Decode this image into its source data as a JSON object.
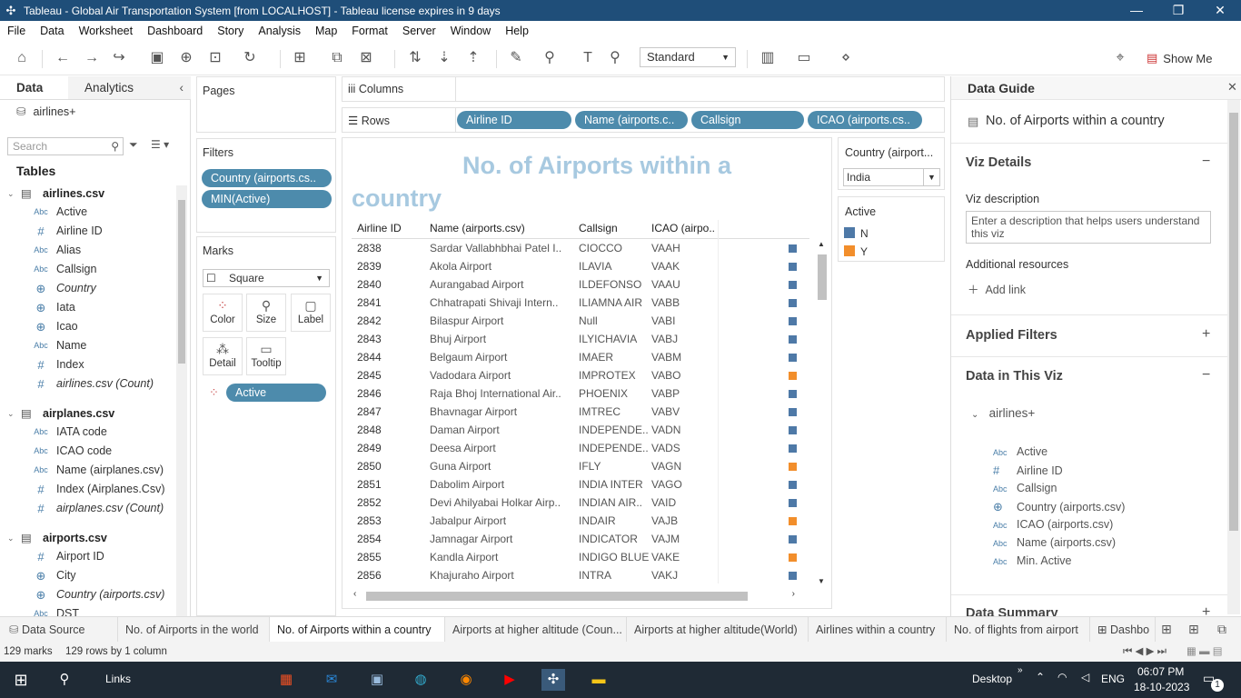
{
  "window": {
    "title": "Tableau - Global Air Transportation System [from LOCALHOST] - Tableau license expires in 9 days"
  },
  "menu": [
    "File",
    "Data",
    "Worksheet",
    "Dashboard",
    "Story",
    "Analysis",
    "Map",
    "Format",
    "Server",
    "Window",
    "Help"
  ],
  "toolbar": {
    "fit_mode": "Standard",
    "show_me": "Show Me"
  },
  "left_panel": {
    "tab_data": "Data",
    "tab_analytics": "Analytics",
    "data_source": "airlines+",
    "search_placeholder": "Search",
    "tables_heading": "Tables",
    "tables": [
      {
        "name": "airlines.csv",
        "fields": [
          {
            "type": "Abc",
            "name": "Active"
          },
          {
            "type": "#",
            "name": "Airline ID"
          },
          {
            "type": "Abc",
            "name": "Alias"
          },
          {
            "type": "Abc",
            "name": "Callsign"
          },
          {
            "type": "globe",
            "name": "Country"
          },
          {
            "type": "globe",
            "name": "Iata"
          },
          {
            "type": "globe",
            "name": "Icao"
          },
          {
            "type": "Abc",
            "name": "Name"
          },
          {
            "type": "#",
            "name": "Index"
          },
          {
            "type": "#",
            "name": "airlines.csv (Count)"
          }
        ]
      },
      {
        "name": "airplanes.csv",
        "fields": [
          {
            "type": "Abc",
            "name": "IATA code"
          },
          {
            "type": "Abc",
            "name": "ICAO code"
          },
          {
            "type": "Abc",
            "name": "Name (airplanes.csv)"
          },
          {
            "type": "#",
            "name": "Index (Airplanes.Csv)"
          },
          {
            "type": "#",
            "name": "airplanes.csv (Count)"
          }
        ]
      },
      {
        "name": "airports.csv",
        "fields": [
          {
            "type": "#",
            "name": "Airport ID"
          },
          {
            "type": "globe",
            "name": "City"
          },
          {
            "type": "globe",
            "name": "Country (airports.csv)"
          },
          {
            "type": "Abc",
            "name": "DST"
          }
        ]
      }
    ]
  },
  "pages": {
    "title": "Pages"
  },
  "filters": {
    "title": "Filters",
    "items": [
      "Country (airports.cs..",
      "MIN(Active)"
    ]
  },
  "marks": {
    "title": "Marks",
    "type": "Square",
    "buttons": [
      "Color",
      "Size",
      "Label",
      "Detail",
      "Tooltip"
    ],
    "color_pill": "Active"
  },
  "shelves": {
    "columns_label": "Columns",
    "rows_label": "Rows",
    "rows_pills": [
      "Airline ID",
      "Name (airports.c..",
      "Callsign",
      "ICAO (airports.cs.."
    ]
  },
  "viz": {
    "title_line1": "No. of Airports within a",
    "title_line2": "country",
    "headers": [
      "Airline ID",
      "Name (airports.csv)",
      "Callsign",
      "ICAO (airpo.."
    ],
    "rows": [
      {
        "id": "2838",
        "name": "Sardar Vallabhbhai Patel I..",
        "callsign": "CIOCCO",
        "icao": "VAAH",
        "active": "N"
      },
      {
        "id": "2839",
        "name": "Akola Airport",
        "callsign": "ILAVIA",
        "icao": "VAAK",
        "active": "N"
      },
      {
        "id": "2840",
        "name": "Aurangabad Airport",
        "callsign": "ILDEFONSO",
        "icao": "VAAU",
        "active": "N"
      },
      {
        "id": "2841",
        "name": "Chhatrapati Shivaji Intern..",
        "callsign": "ILIAMNA AIR",
        "icao": "VABB",
        "active": "N"
      },
      {
        "id": "2842",
        "name": "Bilaspur Airport",
        "callsign": "Null",
        "icao": "VABI",
        "active": "N"
      },
      {
        "id": "2843",
        "name": "Bhuj Airport",
        "callsign": "ILYICHAVIA",
        "icao": "VABJ",
        "active": "N"
      },
      {
        "id": "2844",
        "name": "Belgaum Airport",
        "callsign": "IMAER",
        "icao": "VABM",
        "active": "N"
      },
      {
        "id": "2845",
        "name": "Vadodara Airport",
        "callsign": "IMPROTEX",
        "icao": "VABO",
        "active": "Y"
      },
      {
        "id": "2846",
        "name": "Raja Bhoj International Air..",
        "callsign": "PHOENIX",
        "icao": "VABP",
        "active": "N"
      },
      {
        "id": "2847",
        "name": "Bhavnagar Airport",
        "callsign": "IMTREC",
        "icao": "VABV",
        "active": "N"
      },
      {
        "id": "2848",
        "name": "Daman Airport",
        "callsign": "INDEPENDE..",
        "icao": "VADN",
        "active": "N"
      },
      {
        "id": "2849",
        "name": "Deesa Airport",
        "callsign": "INDEPENDE..",
        "icao": "VADS",
        "active": "N"
      },
      {
        "id": "2850",
        "name": "Guna Airport",
        "callsign": "IFLY",
        "icao": "VAGN",
        "active": "Y"
      },
      {
        "id": "2851",
        "name": "Dabolim Airport",
        "callsign": "INDIA INTER",
        "icao": "VAGO",
        "active": "N"
      },
      {
        "id": "2852",
        "name": "Devi Ahilyabai Holkar Airp..",
        "callsign": "INDIAN AIR..",
        "icao": "VAID",
        "active": "N"
      },
      {
        "id": "2853",
        "name": "Jabalpur Airport",
        "callsign": "INDAIR",
        "icao": "VAJB",
        "active": "Y"
      },
      {
        "id": "2854",
        "name": "Jamnagar Airport",
        "callsign": "INDICATOR",
        "icao": "VAJM",
        "active": "N"
      },
      {
        "id": "2855",
        "name": "Kandla Airport",
        "callsign": "INDIGO BLUE",
        "icao": "VAKE",
        "active": "Y"
      },
      {
        "id": "2856",
        "name": "Khajuraho Airport",
        "callsign": "INTRA",
        "icao": "VAKJ",
        "active": "N"
      }
    ]
  },
  "filter_card": {
    "title": "Country (airport...",
    "value": "India"
  },
  "legend": {
    "title": "Active",
    "items": [
      {
        "label": "N",
        "color": "#4e79a7"
      },
      {
        "label": "Y",
        "color": "#f28e2b"
      }
    ]
  },
  "data_guide": {
    "title": "Data Guide",
    "sheet_name": "No. of Airports within a country",
    "viz_details": "Viz Details",
    "viz_description_label": "Viz description",
    "viz_description_placeholder": "Enter a description that helps users understand this viz",
    "additional_resources": "Additional resources",
    "add_link": "Add link",
    "applied_filters": "Applied Filters",
    "data_in_viz": "Data in This Viz",
    "source": "airlines+",
    "fields": [
      {
        "type": "Abc",
        "name": "Active"
      },
      {
        "type": "#",
        "name": "Airline ID"
      },
      {
        "type": "Abc",
        "name": "Callsign"
      },
      {
        "type": "globe",
        "name": "Country (airports.csv)"
      },
      {
        "type": "Abc",
        "name": "ICAO (airports.csv)"
      },
      {
        "type": "Abc",
        "name": "Name (airports.csv)"
      },
      {
        "type": "Abc",
        "name": "Min. Active"
      }
    ],
    "data_summary": "Data Summary"
  },
  "sheets": [
    "Data Source",
    "No. of Airports in the world",
    "No. of Airports within a country",
    "Airports at higher altitude (Coun...",
    "Airports at higher altitude(World)",
    "Airlines within a country",
    "No. of flights from airport",
    "Dashbo"
  ],
  "status": {
    "marks": "129 marks",
    "rows": "129 rows by 1 column"
  },
  "taskbar": {
    "links": "Links",
    "desktop": "Desktop",
    "lang": "ENG",
    "time": "06:07 PM",
    "date": "18-10-2023",
    "notif_count": "1"
  },
  "colors": {
    "pill": "#4d8bac",
    "n": "#4e79a7",
    "y": "#f28e2b",
    "title": "#a7c9e0"
  }
}
